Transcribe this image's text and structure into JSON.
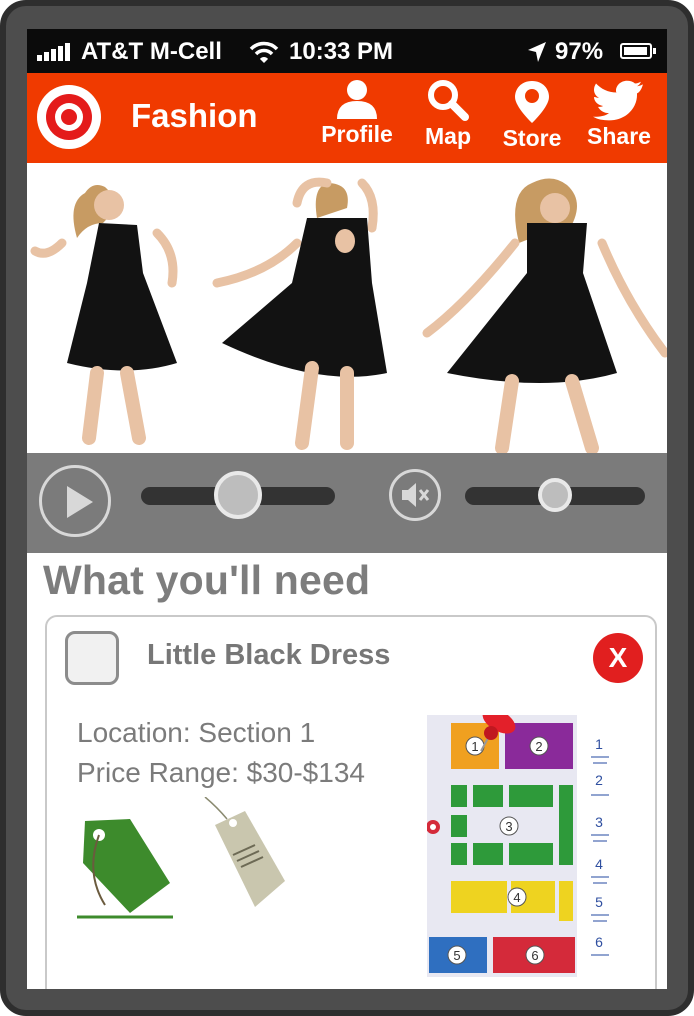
{
  "status": {
    "carrier": "AT&T M-Cell",
    "time": "10:33 PM",
    "battery": "97%",
    "battery_level": 0.97
  },
  "nav": {
    "title": "Fashion",
    "profile": "Profile",
    "map": "Map",
    "store": "Store",
    "share": "Share"
  },
  "player": {
    "progress": 0.5,
    "volume": 0.5
  },
  "section": {
    "heading": "What you'll need"
  },
  "item": {
    "name": "Little Black Dress",
    "close": "X",
    "location": "Location: Section 1",
    "price": "Price Range: $30-$134"
  },
  "store_map": {
    "sections": [
      "1",
      "2",
      "3",
      "4",
      "5",
      "6"
    ]
  },
  "colors": {
    "brand": "#f03a00",
    "close": "#e11f1f"
  }
}
